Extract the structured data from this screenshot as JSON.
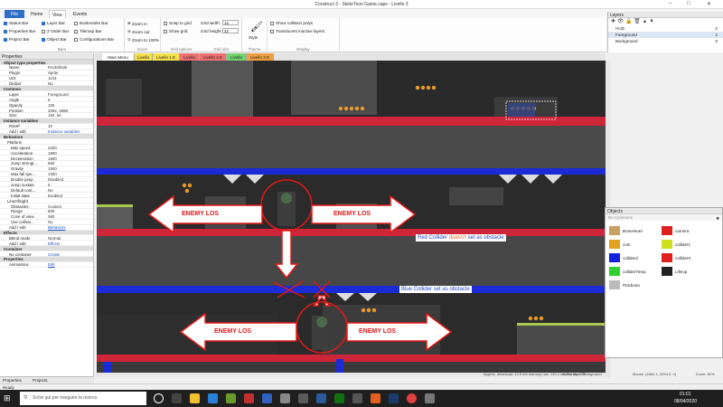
{
  "window": {
    "title": "Construct 2 - SkeleToon Game.caps - Livello 3"
  },
  "ribbon_tabs": [
    "File",
    "Home",
    "View",
    "Events"
  ],
  "ribbon": {
    "bars": {
      "items": [
        "Status Bar",
        "Properties Bar",
        "Project Bar",
        "Layer Bar",
        "Z Order Bar",
        "Object Bar",
        "Bookmarks Bar",
        "Tilemap Bar",
        "Configurations Bar"
      ],
      "caption": "Bars"
    },
    "zoom": {
      "items": [
        "Zoom in",
        "Zoom out",
        "Zoom to 100%"
      ],
      "caption": "Zoom"
    },
    "grid": {
      "items": [
        "Snap to grid",
        "Show grid"
      ],
      "width_label": "Grid width:",
      "width_value": "16",
      "height_label": "Grid height:",
      "height_value": "32",
      "caption": "Grid options",
      "caption2": "Grid size"
    },
    "theme": {
      "label": "Style",
      "caption": "Theme"
    },
    "display": {
      "items": [
        "Show collision polys",
        "Translucent inactive layers"
      ],
      "caption": "Display"
    }
  },
  "layers": {
    "title": "Layers",
    "rows": [
      {
        "name": "HUD",
        "n": "2"
      },
      {
        "name": "Foreground",
        "n": "1"
      },
      {
        "name": "Background",
        "n": "0"
      }
    ]
  },
  "properties": {
    "title": "Properties",
    "rows": [
      {
        "t": "hdr",
        "k": "Object type properties",
        "v": ""
      },
      {
        "t": "",
        "k": "Name",
        "v": "RockShark"
      },
      {
        "t": "",
        "k": "Plugin",
        "v": "Sprite"
      },
      {
        "t": "",
        "k": "UID",
        "v": "1133"
      },
      {
        "t": "",
        "k": "Global",
        "v": "No"
      },
      {
        "t": "hdr",
        "k": "Common",
        "v": ""
      },
      {
        "t": "",
        "k": "Layer",
        "v": "Foreground"
      },
      {
        "t": "",
        "k": "Angle",
        "v": "0"
      },
      {
        "t": "",
        "k": "Opacity",
        "v": "100"
      },
      {
        "t": "",
        "k": "Position",
        "v": "3392, 2688"
      },
      {
        "t": "",
        "k": "Size",
        "v": "192, 64"
      },
      {
        "t": "hdr",
        "k": "Instance variables",
        "v": ""
      },
      {
        "t": "",
        "k": "RSHP",
        "v": "10"
      },
      {
        "t": "",
        "k": "Add / edit",
        "v": "Instance variables",
        "link": true
      },
      {
        "t": "hdr",
        "k": "Behaviors",
        "v": ""
      },
      {
        "t": "sub",
        "k": "Platform",
        "v": ""
      },
      {
        "t": "deep",
        "k": "Max speed",
        "v": "2200"
      },
      {
        "t": "deep",
        "k": "Acceleration",
        "v": "1800"
      },
      {
        "t": "deep",
        "k": "Deceleration",
        "v": "1600"
      },
      {
        "t": "deep",
        "k": "Jump strengt...",
        "v": "650"
      },
      {
        "t": "deep",
        "k": "Gravity",
        "v": "1500"
      },
      {
        "t": "deep",
        "k": "Max fall spe...",
        "v": "1000"
      },
      {
        "t": "deep",
        "k": "Double jump",
        "v": "Disabled"
      },
      {
        "t": "deep",
        "k": "Jump sustain",
        "v": "0"
      },
      {
        "t": "deep",
        "k": "Default cont...",
        "v": "No"
      },
      {
        "t": "deep",
        "k": "Initial state",
        "v": "Enabled"
      },
      {
        "t": "sub",
        "k": "LineOfSight",
        "v": ""
      },
      {
        "t": "deep",
        "k": "Obstacles",
        "v": "Custom"
      },
      {
        "t": "deep",
        "k": "Range",
        "v": "800"
      },
      {
        "t": "deep",
        "k": "Cone of view",
        "v": "360"
      },
      {
        "t": "deep",
        "k": "Use collisio...",
        "v": "No"
      },
      {
        "t": "",
        "k": "Add / edit",
        "v": "Behaviors",
        "link": true
      },
      {
        "t": "hdr",
        "k": "Effects",
        "v": ""
      },
      {
        "t": "",
        "k": "Blend mode",
        "v": "Normal"
      },
      {
        "t": "",
        "k": "Add / edit",
        "v": "Effects",
        "link": true
      },
      {
        "t": "hdr",
        "k": "Container",
        "v": ""
      },
      {
        "t": "",
        "k": "No container",
        "v": "Create",
        "link": true
      },
      {
        "t": "hdr",
        "k": "Properties",
        "v": ""
      },
      {
        "t": "",
        "k": "Animations",
        "v": "Edit",
        "link": true
      }
    ],
    "bottom_tabs": [
      "Properties",
      "Projects"
    ]
  },
  "doc_tabs": [
    {
      "label": "Main Menu",
      "color": "#ffffff"
    },
    {
      "label": "Livello 1",
      "color": "#f4e04a"
    },
    {
      "label": "Livello 1 E",
      "color": "#f4e04a"
    },
    {
      "label": "Livello 2",
      "color": "#ee7070"
    },
    {
      "label": "Livello 2 E",
      "color": "#ee7070"
    },
    {
      "label": "Livello 3",
      "color": "#6fd46f"
    },
    {
      "label": "Livello 3 E",
      "color": "#f0a040"
    }
  ],
  "annotations": {
    "enemy_los": "ENEMY LOS",
    "red_note_a": "Red Collider ",
    "red_note_b": "doesn't",
    "red_note_c": " set as obstacle",
    "blue_note": "Blue Collider set as obstacle"
  },
  "objects": {
    "title": "Objects",
    "subtitle": "No Commons",
    "items": [
      {
        "name": "BoneHeart",
        "color": "#c8a060"
      },
      {
        "name": "camera",
        "color": "#e02020"
      },
      {
        "name": "coin",
        "color": "#e0a020"
      },
      {
        "name": "collider1",
        "color": "#d0e020"
      },
      {
        "name": "collider2",
        "color": "#1020e0"
      },
      {
        "name": "collider3",
        "color": "#e02020"
      },
      {
        "name": "colliderTemp",
        "color": "#30d030"
      },
      {
        "name": "LifeUp",
        "color": "#222222"
      },
      {
        "name": "Pickbone",
        "color": "#bbbbbb"
      }
    ]
  },
  "status": {
    "left": "Ready",
    "approx": "Approx. download: 12.5 mb  memory use: 120.1 mb  Events: 255",
    "layer": "Active layer: Foreground",
    "mouse": "Mouse: (2481.1, 3294.0, 0)",
    "zoom": "Zoom: 61%"
  },
  "taskbar": {
    "search": "Scrivi qui per eseguire la ricerca",
    "time": "01:01",
    "date": "08/04/2020"
  }
}
